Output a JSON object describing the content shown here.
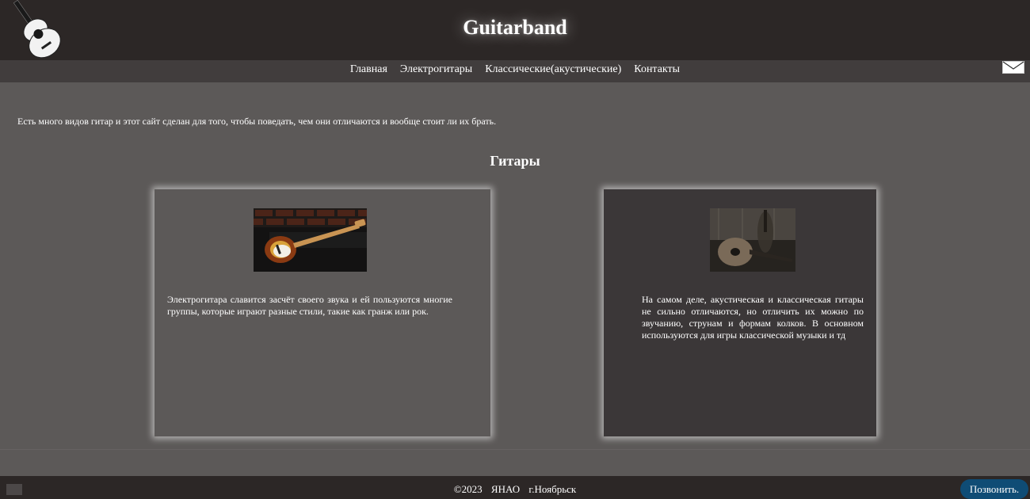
{
  "header": {
    "title": "Guitarband",
    "logo_icon": "acoustic-guitar-logo-icon"
  },
  "nav": {
    "items": [
      {
        "label": "Главная"
      },
      {
        "label": "Электрогитары"
      },
      {
        "label": "Классические(акустические)"
      },
      {
        "label": "Контакты"
      }
    ],
    "mail_icon": "envelope-icon"
  },
  "intro": {
    "text": "Есть много видов гитар и этот сайт сделан для того, чтобы поведать, чем они отличаются и вообще стоит ли их брать."
  },
  "section": {
    "title": "Гитары"
  },
  "cards": [
    {
      "image_icon": "electric-guitar-photo",
      "text": "Электрогитара славится засчёт своего звука и ей пользуются многие группы, которые играют разные стили, такие как гранж или рок."
    },
    {
      "image_icon": "acoustic-guitar-photo",
      "text": "На самом деле, акустическая и классическая гитары не сильно отличаются, но отличить их можно по звучанию, струнам и формам колков. В основном используются для игры классической музыки и тд"
    }
  ],
  "footer": {
    "copyright": "©2023",
    "region": "ЯНАО",
    "city": "г.Ноябрьск",
    "call_label": "Позвонить."
  },
  "colors": {
    "header_bg": "#2c2726",
    "nav_bg": "#413d3d",
    "page_bg": "#5c5958",
    "card_dark_bg": "#3b3738",
    "call_button": "#0f4c75"
  }
}
